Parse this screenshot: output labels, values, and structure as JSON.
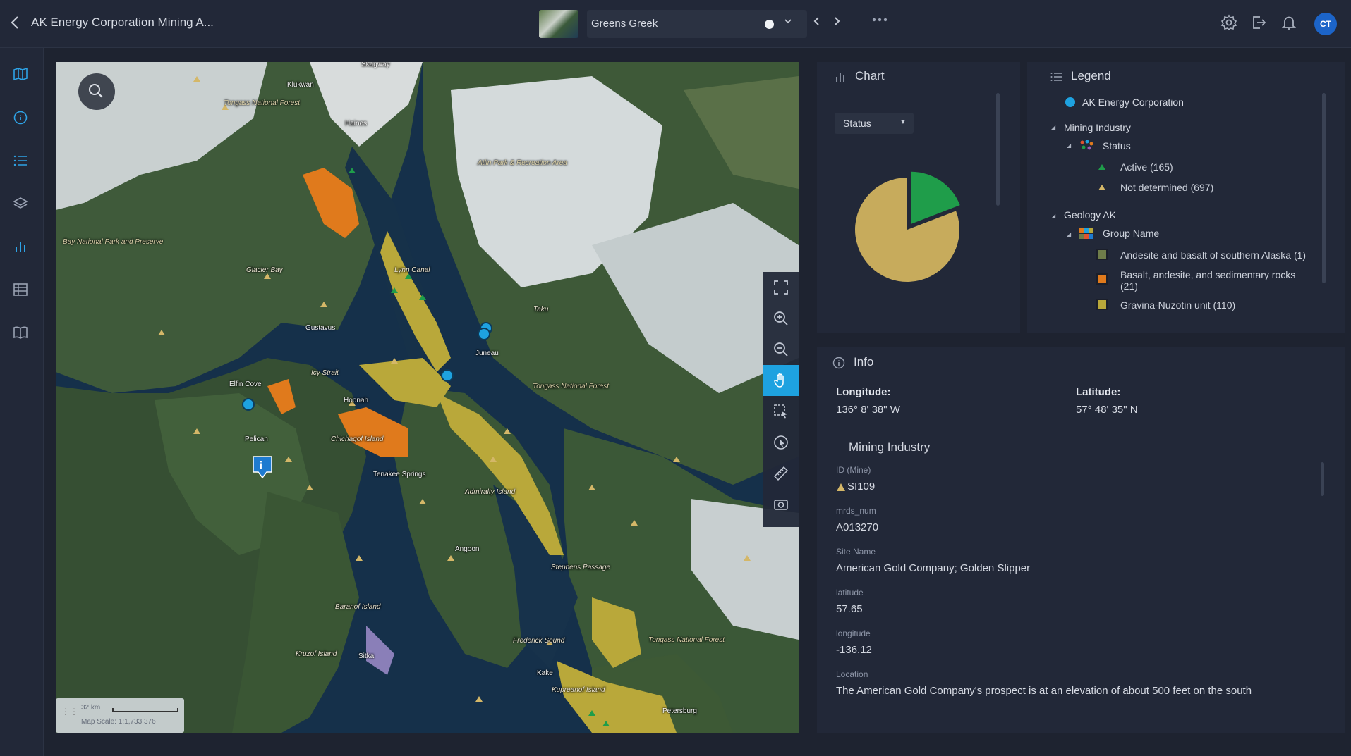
{
  "header": {
    "title": "AK Energy Corporation Mining A...",
    "map_name": "Greens Greek",
    "user_initials": "CT"
  },
  "icons": {
    "back": "chevron-left-icon",
    "settings": "gear-icon",
    "share": "share-icon",
    "notifications": "bell-icon"
  },
  "map": {
    "labels": [
      {
        "text": "Skagway",
        "cls": ""
      },
      {
        "text": "Klukwan",
        "cls": ""
      },
      {
        "text": "Tongass National Forest",
        "cls": "park"
      },
      {
        "text": "Haines",
        "cls": ""
      },
      {
        "text": "Atlin Park & Recreation Area",
        "cls": "park"
      },
      {
        "text": "Bay National Park and Preserve",
        "cls": "park"
      },
      {
        "text": "Glacier Bay",
        "cls": "it"
      },
      {
        "text": "Lynn Canal",
        "cls": "it"
      },
      {
        "text": "Gustavus",
        "cls": ""
      },
      {
        "text": "Juneau",
        "cls": ""
      },
      {
        "text": "Taku",
        "cls": "it"
      },
      {
        "text": "Icy Strait",
        "cls": "it"
      },
      {
        "text": "Elfin Cove",
        "cls": ""
      },
      {
        "text": "Hoonah",
        "cls": ""
      },
      {
        "text": "Tongass National Forest",
        "cls": "park"
      },
      {
        "text": "Pelican",
        "cls": ""
      },
      {
        "text": "Chichagof Island",
        "cls": "it"
      },
      {
        "text": "Tenakee Springs",
        "cls": ""
      },
      {
        "text": "Admiralty Island",
        "cls": "it"
      },
      {
        "text": "Angoon",
        "cls": ""
      },
      {
        "text": "Stephens Passage",
        "cls": "it"
      },
      {
        "text": "Baranof Island",
        "cls": "it"
      },
      {
        "text": "Frederick Sound",
        "cls": "it"
      },
      {
        "text": "Tongass National Forest",
        "cls": "park"
      },
      {
        "text": "Kruzof Island",
        "cls": "it"
      },
      {
        "text": "Sitka",
        "cls": ""
      },
      {
        "text": "Kake",
        "cls": ""
      },
      {
        "text": "Kupreanof Island",
        "cls": "it"
      },
      {
        "text": "Petersburg",
        "cls": ""
      }
    ],
    "scale_distance": "32 km",
    "scale_text": "Map Scale: 1:1,733,376",
    "tools": [
      "fullscreen-icon",
      "zoom-in-icon",
      "zoom-out-icon",
      "pan-hand-icon",
      "select-box-icon",
      "identify-icon",
      "measure-ruler-icon",
      "screenshot-icon"
    ]
  },
  "chart_panel": {
    "title": "Chart",
    "dropdown_value": "Status",
    "chart_data": {
      "type": "pie",
      "title": "",
      "slices": [
        {
          "label": "Not determined",
          "value": 697,
          "color": "#c7ab5c"
        },
        {
          "label": "Active",
          "value": 165,
          "color": "#1f9d4a"
        }
      ]
    }
  },
  "legend": {
    "title": "Legend",
    "ak_energy": "AK Energy Corporation",
    "mining_industry": "Mining Industry",
    "status": "Status",
    "active": "Active (165)",
    "not_determined": "Not determined (697)",
    "geology": "Geology AK",
    "group_name": "Group Name",
    "andesite": "Andesite and basalt of southern Alaska (1)",
    "basalt_line1": "Basalt, andesite, and sedimentary rocks",
    "basalt_line2": "(21)",
    "gravina": "Gravina-Nuzotin unit (110)",
    "colors": {
      "andesite": "#6f7d4a",
      "basalt": "#e07a1c",
      "gravina": "#b9a83a",
      "ak_energy": "#1ea2e0"
    }
  },
  "info": {
    "title": "Info",
    "longitude_label": "Longitude:",
    "longitude_value": "136° 8' 38\" W",
    "latitude_label": "Latitude:",
    "latitude_value": "57° 48' 35\" N",
    "layer_name": "Mining Industry",
    "fields": [
      {
        "label": "ID (Mine)",
        "value": "SI109"
      },
      {
        "label": "mrds_num",
        "value": "A013270"
      },
      {
        "label": "Site Name",
        "value": "American Gold Company; Golden Slipper"
      },
      {
        "label": "latitude",
        "value": "57.65"
      },
      {
        "label": "longitude",
        "value": "-136.12"
      },
      {
        "label": "Location",
        "value": "The American Gold Company's prospect is at an elevation of about 500 feet on the south"
      }
    ]
  }
}
